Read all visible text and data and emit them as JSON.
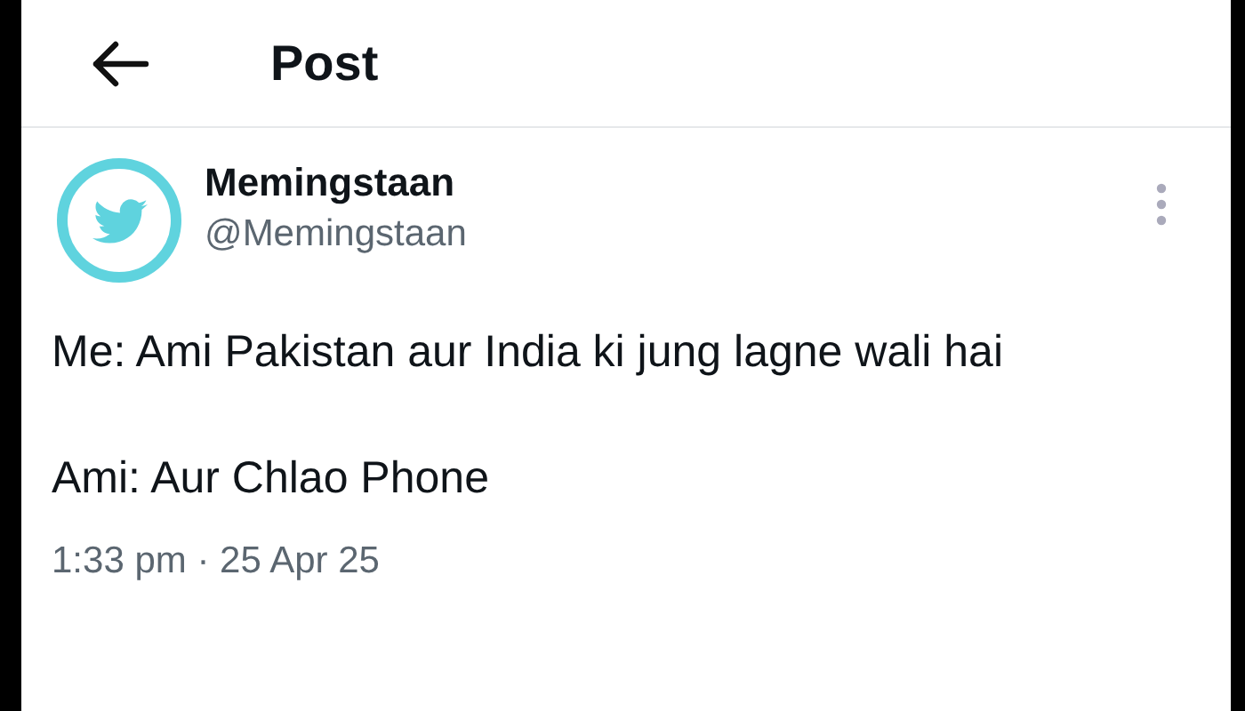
{
  "header": {
    "title": "Post"
  },
  "post": {
    "author": {
      "name": "Memingstaan",
      "handle": "@Memingstaan"
    },
    "paragraphs": [
      "Me: Ami Pakistan aur India ki jung lagne wali hai",
      "Ami: Aur Chlao Phone"
    ],
    "timestamp": "1:33 pm · 25 Apr 25"
  }
}
